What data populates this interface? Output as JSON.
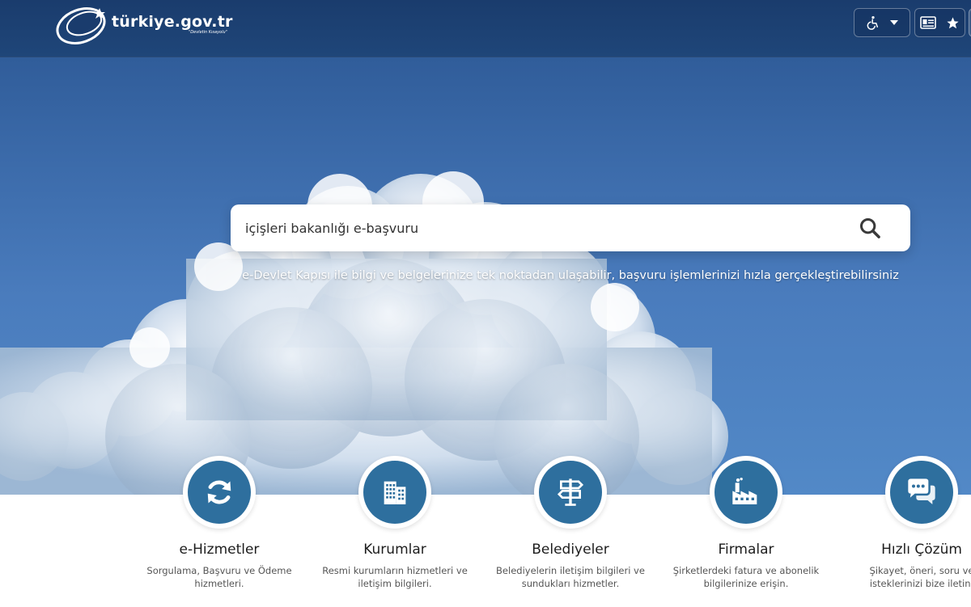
{
  "header": {
    "logo_text": "türkiye.gov.tr",
    "logo_tagline": "\"Devletin Kısayolu\""
  },
  "search": {
    "value": "içişleri bakanlığı e-başvuru",
    "tagline": "e-Devlet Kapısı ile bilgi ve belgelerinize tek noktadan ulaşabilir, başvuru işlemlerinizi hızla gerçekleştirebilirsiniz"
  },
  "services": [
    {
      "title": "e-Hizmetler",
      "desc": "Sorgulama, Başvuru ve Ödeme\nhizmetleri.",
      "icon": "refresh-icon"
    },
    {
      "title": "Kurumlar",
      "desc": "Resmi kurumların hizmetleri ve\niletişim bilgileri.",
      "icon": "building-icon"
    },
    {
      "title": "Belediyeler",
      "desc": "Belediyelerin iletişim bilgileri ve\nsundukları hizmetler.",
      "icon": "signpost-icon"
    },
    {
      "title": "Firmalar",
      "desc": "Şirketlerdeki fatura ve abonelik\nbilgilerinize erişin.",
      "icon": "factory-icon"
    },
    {
      "title": "Hızlı Çözüm",
      "desc": "Şikayet, öneri, soru ve\nisteklerinizi bize iletin.",
      "icon": "chat-icon"
    }
  ],
  "colors": {
    "header_bg": "#1a3c6d",
    "sky": "#4a7cbd",
    "service_icon_bg": "#2e6f9e"
  }
}
